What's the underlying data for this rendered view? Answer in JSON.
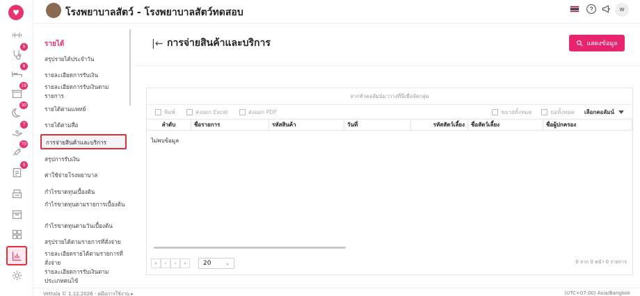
{
  "app": {
    "hospital_name": "โรงพยาบาลสัตว์ - โรงพยาบาลสัตว์ทดสอบ",
    "user_initial": "w",
    "accent_color": "#e8346b"
  },
  "rail": {
    "badges": {
      "appointments": "9",
      "admit": "8",
      "shop": "19",
      "night": "30",
      "hand": "7",
      "vaccine": "70",
      "lab": "9"
    }
  },
  "submenu": {
    "title": "รายได้",
    "items": [
      "สรุปรายได้ประจำวัน",
      "รายละเอียดการรับเงิน",
      "รายละเอียดการรับเงินตามรายการ",
      "รายได้ตามแพทย์",
      "รายได้ตามสื่อ",
      "การจ่ายสินค้าและบริการ",
      "สรุปการรับเงิน",
      "ค่าใช้จ่ายโรงพยาบาล",
      "กำไรขาดทุนเบื้องต้น",
      "กำไรขาดทุนตามรายการเบื้องต้น",
      "กำไรขาดทุนตามวันเบื้องต้น",
      "สรุปรายได้ตามรายการที่สั่งจ่าย",
      "รายละเอียดรายได้ตามรายการที่สั่งจ่าย",
      "รายละเอียดการรับเงินตามประเภทคนไข้"
    ]
  },
  "main": {
    "title": "การจ่ายสินค้าและบริการ",
    "show_button": "แสดงข้อมูล",
    "grid": {
      "group_hint": "ลากหัวคอลัมน์มาวางที่นี่เพื่อจัดกลุ่ม",
      "toolbar": {
        "print": "พิมพ์",
        "excel": "ส่งออก Excel",
        "pdf": "ส่งออก PDF",
        "expand_all": "ขยายทั้งหมด",
        "collapse_all": "ย่อทั้งหมด",
        "choose_columns": "เลือกคอลัมน์"
      },
      "columns": [
        "ลำดับ",
        "ชื่อรายการ",
        "รหัสสินค้า",
        "วันที่",
        "รหัสสัตว์เลี้ยง",
        "ชื่อสัตว์เลี้ยง",
        "ชื่อผู้ปกครอง"
      ],
      "no_data": "ไม่พบข้อมูล",
      "page_size": "20",
      "page_info": "0 จาก 0 หน้า 0 รายการ"
    }
  },
  "footer": {
    "left": "Vettala © 1.12.2026 · คู่มือการใช้งาน ▸",
    "right": "(UTC+07:00) Asia/Bangkok"
  }
}
